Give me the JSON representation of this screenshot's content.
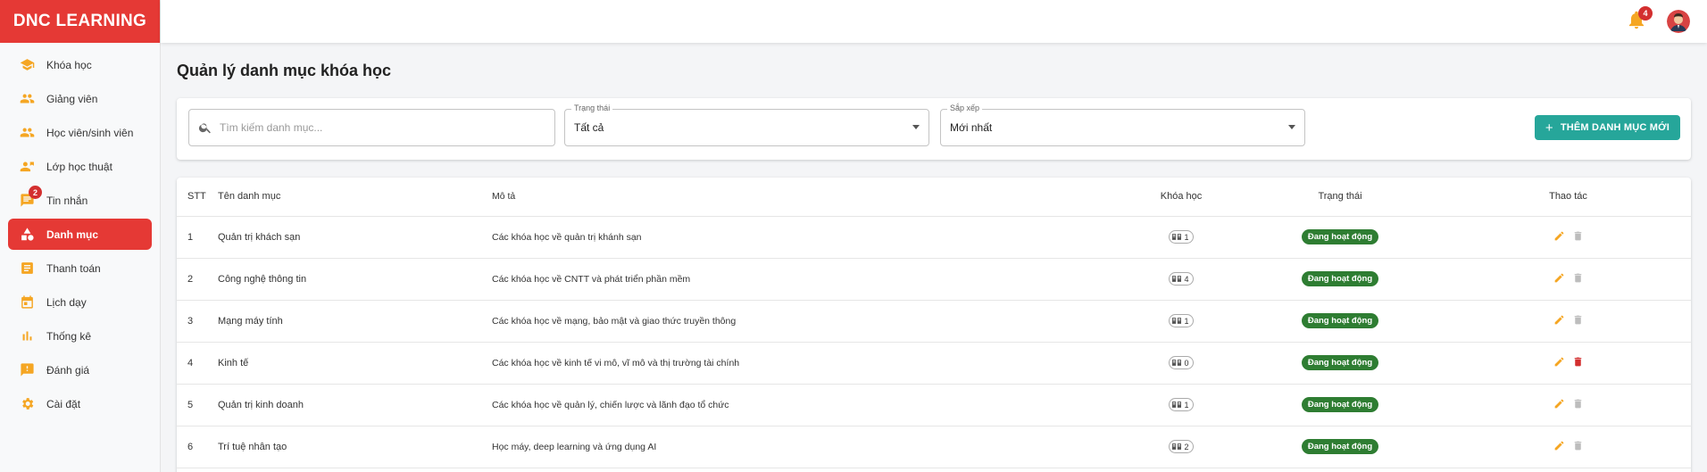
{
  "brand": "DNC LEARNING",
  "colors": {
    "primary": "#e53935",
    "accent": "#26a69a",
    "success": "#2e7d32",
    "icon_orange": "#f5a623"
  },
  "sidebar": {
    "items": [
      {
        "label": "Khóa học",
        "icon": "graduation-cap-icon"
      },
      {
        "label": "Giảng viên",
        "icon": "people-icon"
      },
      {
        "label": "Học viên/sinh viên",
        "icon": "people-icon"
      },
      {
        "label": "Lớp học thuật",
        "icon": "person-board-icon"
      },
      {
        "label": "Tin nhắn",
        "icon": "chat-icon",
        "badge": "2"
      },
      {
        "label": "Danh mục",
        "icon": "category-icon",
        "active": true
      },
      {
        "label": "Thanh toán",
        "icon": "list-icon"
      },
      {
        "label": "Lịch dạy",
        "icon": "calendar-icon"
      },
      {
        "label": "Thống kê",
        "icon": "bar-chart-icon"
      },
      {
        "label": "Đánh giá",
        "icon": "feedback-icon"
      },
      {
        "label": "Cài đặt",
        "icon": "gear-icon"
      }
    ]
  },
  "topbar": {
    "notification_count": "4"
  },
  "page": {
    "title": "Quản lý danh mục khóa học"
  },
  "filters": {
    "search_placeholder": "Tìm kiếm danh mục...",
    "status_label": "Trạng thái",
    "status_value": "Tất cả",
    "sort_label": "Sắp xếp",
    "sort_value": "Mới nhất",
    "add_button": "THÊM DANH MỤC MỚI"
  },
  "table": {
    "headers": {
      "stt": "STT",
      "name": "Tên danh mục",
      "desc": "Mô tả",
      "courses": "Khóa học",
      "status": "Trạng thái",
      "actions": "Thao tác"
    },
    "rows": [
      {
        "stt": "1",
        "name": "Quản trị khách sạn",
        "desc": "Các khóa học về quản trị khánh sạn",
        "courses": "1",
        "status": "Đang hoạt động",
        "can_delete": false
      },
      {
        "stt": "2",
        "name": "Công nghệ thông tin",
        "desc": "Các khóa học về CNTT và phát triển phần mềm",
        "courses": "4",
        "status": "Đang hoạt động",
        "can_delete": false
      },
      {
        "stt": "3",
        "name": "Mạng máy tính",
        "desc": "Các khóa học về mạng, bảo mật và giao thức truyền thông",
        "courses": "1",
        "status": "Đang hoạt động",
        "can_delete": false
      },
      {
        "stt": "4",
        "name": "Kinh tế",
        "desc": "Các khóa học về kinh tế vi mô, vĩ mô và thị trường tài chính",
        "courses": "0",
        "status": "Đang hoạt động",
        "can_delete": true
      },
      {
        "stt": "5",
        "name": "Quản trị kinh doanh",
        "desc": "Các khóa học về quản lý, chiến lược và lãnh đạo tổ chức",
        "courses": "1",
        "status": "Đang hoạt động",
        "can_delete": false
      },
      {
        "stt": "6",
        "name": "Trí tuệ nhân tạo",
        "desc": "Học máy, deep learning và ứng dụng AI",
        "courses": "2",
        "status": "Đang hoạt động",
        "can_delete": false
      }
    ]
  }
}
